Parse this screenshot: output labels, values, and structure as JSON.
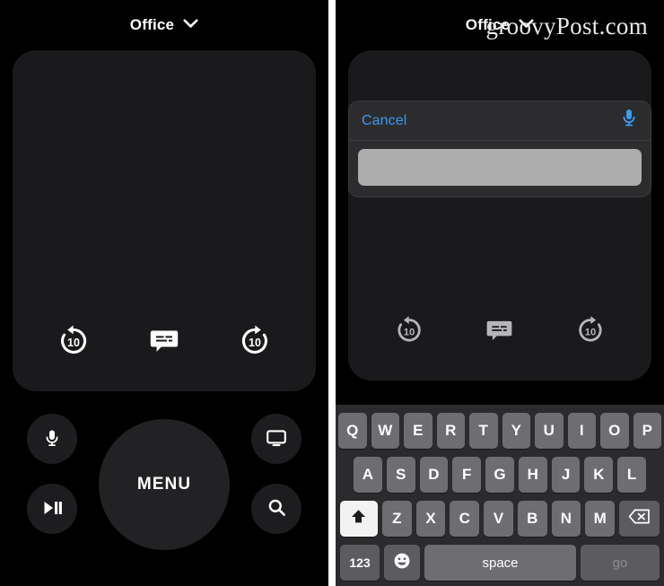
{
  "panels": {
    "left": {
      "header": {
        "title": "Office",
        "chevron_icon": "chevron-down-icon"
      },
      "touchpad": {
        "label": "touchpad"
      },
      "media_controls": [
        {
          "name": "skip-back-10-icon",
          "label": "10"
        },
        {
          "name": "subtitles-icon",
          "label": ""
        },
        {
          "name": "skip-forward-10-icon",
          "label": "10"
        }
      ],
      "remote": {
        "menu_label": "MENU",
        "mic_icon": "microphone-icon",
        "play_pause_icon": "play-pause-icon",
        "tv_icon": "tv-icon",
        "search_icon": "search-icon"
      }
    },
    "right": {
      "header": {
        "title": "Office",
        "chevron_icon": "chevron-down-icon"
      },
      "search": {
        "cancel_label": "Cancel",
        "mic_icon": "microphone-icon",
        "input_value": "",
        "input_placeholder": ""
      },
      "media_controls": [
        {
          "name": "skip-back-10-icon",
          "label": "10"
        },
        {
          "name": "subtitles-icon",
          "label": ""
        },
        {
          "name": "skip-forward-10-icon",
          "label": "10"
        }
      ],
      "keyboard": {
        "row1": [
          "Q",
          "W",
          "E",
          "R",
          "T",
          "Y",
          "U",
          "I",
          "O",
          "P"
        ],
        "row2": [
          "A",
          "S",
          "D",
          "F",
          "G",
          "H",
          "J",
          "K",
          "L"
        ],
        "row3": [
          "Z",
          "X",
          "C",
          "V",
          "B",
          "N",
          "M"
        ],
        "shift_icon": "shift-arrow-icon",
        "delete_icon": "backspace-icon",
        "numbers_label": "123",
        "emoji_icon": "emoji-smiley-icon",
        "space_label": "space",
        "go_label": "go"
      }
    }
  },
  "watermark": {
    "text": "groovyPost.com"
  },
  "colors": {
    "background": "#000000",
    "touchpad": "#1a1a1c",
    "button": "#1d1d1f",
    "menu_button": "#222224",
    "accent_blue": "#3b9bf0",
    "keyboard_bg": "#2b2b2d",
    "key": "#6d6d72",
    "key_dark": "#5c5c60",
    "key_active": "#f2f2f2",
    "input_field": "#adadad",
    "text": "#ffffff",
    "text_dim": "#8b8b90"
  }
}
